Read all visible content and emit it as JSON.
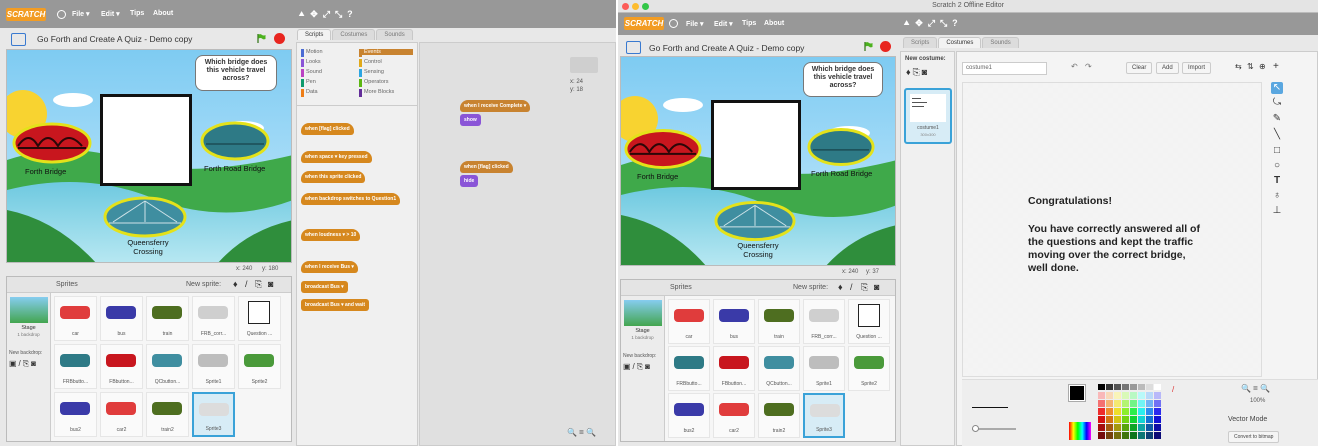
{
  "menubar": {
    "logo": "SCRATCH",
    "items": [
      "File ▾",
      "Edit ▾",
      "Tips",
      "About"
    ],
    "tools": [
      "⯅",
      "✥",
      "⤢",
      "⤡",
      "?"
    ]
  },
  "window_right": {
    "title": "Scratch 2 Offline Editor"
  },
  "project": {
    "title": "Go Forth and Create A Quiz - Demo copy"
  },
  "stage": {
    "question": "Which bridge does this vehicle travel across?",
    "bridges": [
      "Forth Bridge",
      "Forth Road Bridge",
      "Queensferry Crossing"
    ]
  },
  "left": {
    "coords": {
      "x": "x: 240",
      "y": "y: 180"
    },
    "tabs": [
      "Scripts",
      "Costumes",
      "Sounds"
    ],
    "categories_left": [
      "Motion",
      "Looks",
      "Sound",
      "Pen",
      "Data"
    ],
    "categories_right": [
      "Events",
      "Control",
      "Sensing",
      "Operators",
      "More Blocks"
    ],
    "category_colors": {
      "Motion": "#4a6cd4",
      "Looks": "#8a55d7",
      "Sound": "#bb42c3",
      "Pen": "#0e9a6c",
      "Data": "#ee7d16",
      "Events": "#c88330",
      "Control": "#e1a91a",
      "Sensing": "#2ca5e2",
      "Operators": "#5cb712",
      "More Blocks": "#632d99"
    },
    "blocks": [
      "when [flag] clicked",
      "when space ▾ key pressed",
      "when this sprite clicked",
      "when backdrop switches to Question1",
      "when loudness ▾ > 10",
      "when I receive Bus ▾",
      "broadcast Bus ▾",
      "broadcast Bus ▾ and wait"
    ],
    "scripts": {
      "s1_hat": "when I receive  Complete ▾",
      "s1_cmd": "show",
      "s2_hat": "when [flag] clicked",
      "s2_cmd": "hide"
    },
    "sprite_coords": {
      "x": "x: 24",
      "y": "y: 18"
    }
  },
  "sprites_pane": {
    "title": "Sprites",
    "new_sprite": "New sprite:",
    "stage_label": "Stage",
    "stage_sub": "1 backdrop",
    "new_backdrop": "New backdrop:",
    "tiles": [
      "car",
      "bus",
      "train",
      "FRB_corr...",
      "Question ...",
      "FRBbutto...",
      "FBbutton...",
      "QCbutton...",
      "Sprite1",
      "Sprite2",
      "bus2",
      "car2",
      "train2",
      "Sprite3"
    ],
    "tiles_right_mid": [
      "FRBbutto...",
      "FBbutton...",
      "QCbutton...",
      "Sprite1",
      "Sprite2"
    ]
  },
  "right": {
    "coords": {
      "x": "x: 240",
      "y": "y: 37"
    },
    "tabs": [
      "Scripts",
      "Costumes",
      "Sounds"
    ],
    "new_costume": "New costume:",
    "costume_name": "costume1",
    "buttons": [
      "Clear",
      "Add",
      "Import"
    ],
    "costume_thumb_label": "costume1",
    "costume_thumb_sub": "300x300",
    "congrats_title": "Congratulations!",
    "congrats_body": "You have correctly answered all of the questions and kept the traffic moving over the correct bridge, well done.",
    "zoom_pct": "100%",
    "mode": "Vector Mode",
    "convert": "Convert to bitmap"
  },
  "colors": {
    "menubar": "#989898",
    "accent": "#f29c23",
    "selection": "#3aa2d8"
  }
}
